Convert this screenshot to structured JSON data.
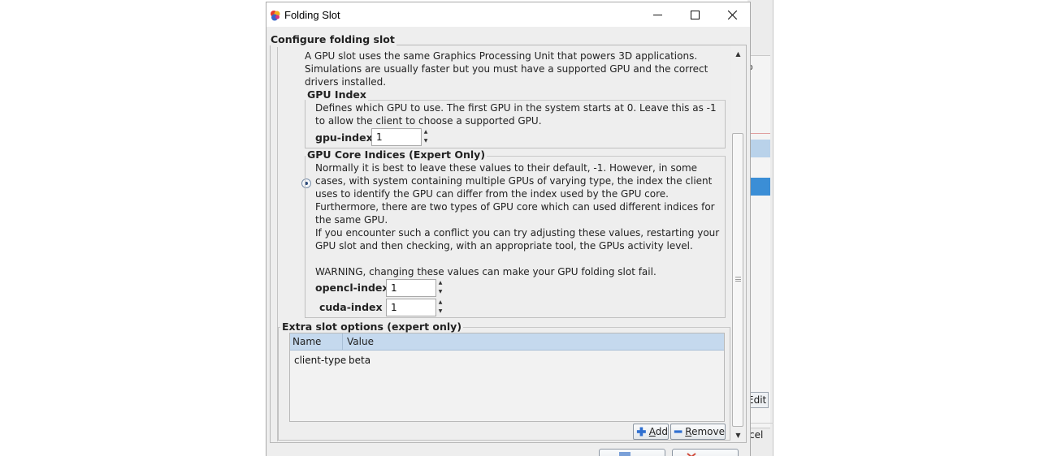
{
  "background_window": {
    "edit_label": "Edit",
    "cancel_fragment": "cel",
    "glyph": "o"
  },
  "dialog": {
    "title": "Folding Slot",
    "section_title": "Configure folding slot",
    "gpu_description": "A GPU slot uses the same Graphics Processing Unit that powers 3D applications. Simulations are usually faster but you must have a supported GPU and the correct drivers installed.",
    "gpu_index": {
      "title": "GPU Index",
      "description": "Defines which GPU to use.  The first GPU in the system starts at 0.  Leave this as -1 to allow the client to choose a supported GPU.",
      "label": "gpu-index",
      "value": "1"
    },
    "gpu_core_indices": {
      "title": "GPU Core Indices (Expert Only)",
      "paragraph1": "Normally it is best to leave these values to their default, -1.  However, in some cases, with system containing multiple GPUs of varying type, the index the client uses to identify the GPU can differ from the index used by the GPU core.  Furthermore, there are two types of GPU core which can used different indices for the same GPU.",
      "paragraph2": "If you encounter such a conflict you can try adjusting these values, restarting your GPU slot and then checking, with an appropriate tool, the GPUs activity level.",
      "paragraph3": "WARNING, changing these values can make your GPU folding slot fail.",
      "opencl_label": "opencl-index",
      "opencl_value": "1",
      "cuda_label": "cuda-index",
      "cuda_value": "1"
    },
    "extra_options": {
      "title": "Extra slot options (expert only)",
      "columns": [
        "Name",
        "Value"
      ],
      "rows": [
        {
          "name": "client-type",
          "value": "beta"
        }
      ],
      "add_label": "Add",
      "add_mnemonic": "A",
      "add_rest": "dd",
      "remove_label": "Remove",
      "remove_mnemonic": "R",
      "remove_rest": "emove"
    }
  },
  "colors": {
    "table_header": "#c5d9ee",
    "selection": "#3b8ed6",
    "dialog_bg": "#eeeeee"
  }
}
